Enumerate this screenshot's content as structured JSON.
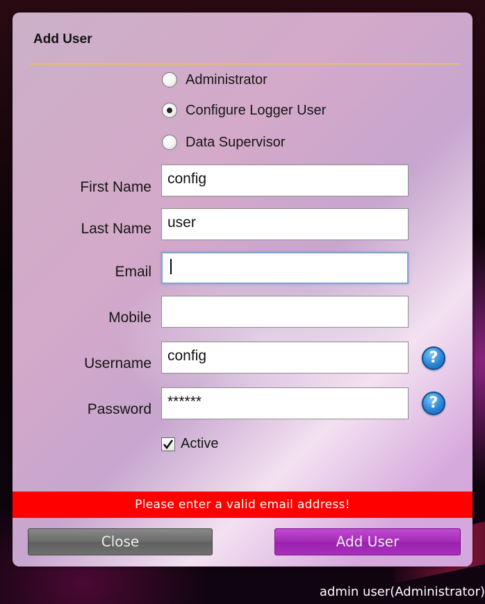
{
  "dialog": {
    "title": "Add User"
  },
  "roles": [
    {
      "label": "Administrator",
      "selected": false
    },
    {
      "label": "Configure Logger User",
      "selected": true
    },
    {
      "label": "Data Supervisor",
      "selected": false
    }
  ],
  "fields": {
    "first_name": {
      "label": "First Name",
      "value": "config"
    },
    "last_name": {
      "label": "Last Name",
      "value": "user"
    },
    "email": {
      "label": "Email",
      "value": ""
    },
    "mobile": {
      "label": "Mobile",
      "value": ""
    },
    "username": {
      "label": "Username",
      "value": "config"
    },
    "password": {
      "label": "Password",
      "value": "******"
    }
  },
  "help_glyph": "?",
  "active": {
    "label": "Active",
    "checked": true
  },
  "error_message": "Please enter a valid email address!",
  "buttons": {
    "close_label": "Close",
    "add_user_label": "Add User"
  },
  "status": {
    "current_user": "admin user(Administrator)"
  },
  "colors": {
    "accent": "#a42ab8",
    "error": "#ff0000",
    "title_rule": "#e8c254"
  }
}
